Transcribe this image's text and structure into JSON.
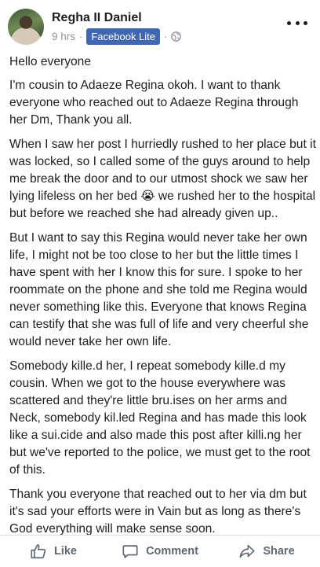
{
  "post": {
    "author": "Regha II Daniel",
    "time": "9 hrs",
    "separator": "·",
    "via_badge": "Facebook Lite",
    "paragraphs": [
      "Hello everyone",
      "I'm cousin to Adaeze Regina okoh. I want to thank everyone who reached out to Adaeze Regina through her Dm, Thank you all.",
      "When I saw her post I hurriedly rushed to her place but it was locked, so I called some of the guys around to help me break the door and to our utmost shock we saw her lying lifeless on her bed 😭 we rushed her to the hospital but before we reached she had already given up..",
      "But I want to say this Regina would never take her own life, I might not be too close to her but the little times I have spent with her I know this for sure. I spoke to her roommate on the phone and she told me Regina would never something like this. Everyone that knows Regina can testify that she was full of life and very cheerful she would never take her own life.",
      "Somebody kille.d her, I repeat somebody kille.d my cousin. When we got to the house everywhere was scattered and they're little bru.ises on her arms and Neck, somebody kil.led Regina and has made this look like a sui.cide and also made this post after killi.ng her but we've reported to the police, we must get to the root of this.",
      "Thank you everyone that reached out to her via dm but it's sad your efforts were in Vain but as long as there's God everything will make sense soon."
    ]
  },
  "actions": {
    "like": "Like",
    "comment": "Comment",
    "share": "Share"
  },
  "icons": {
    "privacy": "globe-icon",
    "more": "more-options-icon",
    "like": "thumbs-up-icon",
    "comment": "comment-bubble-icon",
    "share": "share-arrow-icon"
  },
  "colors": {
    "badge": "#4267b2",
    "text": "#1c1e21",
    "muted": "#90949c",
    "action": "#606770"
  }
}
